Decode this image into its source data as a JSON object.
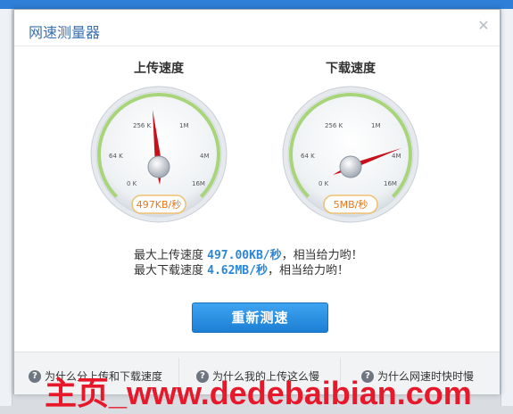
{
  "window": {
    "title": "网速测量器",
    "close_icon": "close-icon"
  },
  "gauges": {
    "upload": {
      "title": "上传速度",
      "readout": "497KB/秒",
      "ticks": [
        "0 K",
        "64 K",
        "256 K",
        "1M",
        "4M",
        "16M"
      ]
    },
    "download": {
      "title": "下载速度",
      "readout": "5MB/秒",
      "ticks": [
        "0 K",
        "64 K",
        "256 K",
        "1M",
        "4M",
        "16M"
      ]
    }
  },
  "stats": {
    "upload_label": "最大上传速度",
    "upload_value": "497.00KB/秒",
    "upload_comment": "，相当给力哟！",
    "download_label": "最大下载速度",
    "download_value": "4.62MB/秒",
    "download_comment": "，相当给力哟！"
  },
  "retest_button": "重新测速",
  "footer": {
    "faq1": "为什么分上传和下载速度",
    "faq2": "为什么我的上传这么慢",
    "faq3": "为什么网速时快时慢"
  },
  "watermark": "主页_www.dedebaibian.com",
  "colors": {
    "accent": "#2a86d9",
    "needle": "#c8101a",
    "gauge_ring": "#a8d47a",
    "watermark": "#e8182b"
  }
}
